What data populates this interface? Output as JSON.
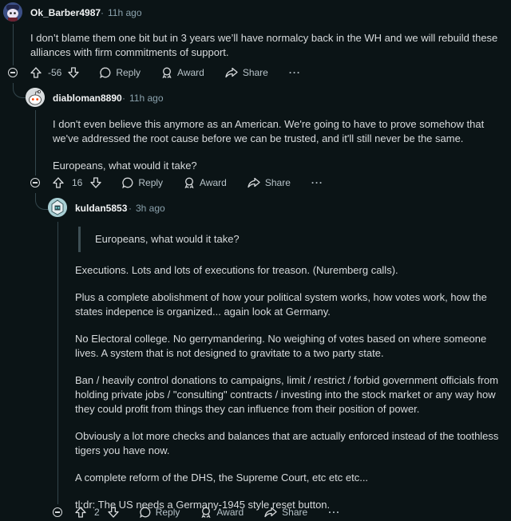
{
  "comments": [
    {
      "username": "Ok_Barber4987",
      "time": "11h ago",
      "paragraphs": [
        "I don’t blame them one bit but in 3 years we’ll have normalcy back in the WH and we will rebuild these alliances with firm commitments of support."
      ],
      "score": "-56",
      "reply": "Reply",
      "award": "Award",
      "share": "Share",
      "more": "···"
    },
    {
      "username": "diabloman8890",
      "time": "11h ago",
      "paragraphs": [
        "I don't even believe this anymore as an American. We're going to have to prove somehow that we've addressed the root cause before we can be trusted, and it'll still never be the same.",
        "Europeans, what would it take?"
      ],
      "score": "16",
      "reply": "Reply",
      "award": "Award",
      "share": "Share",
      "more": "···"
    },
    {
      "username": "kuldan5853",
      "time": "3h ago",
      "quote": "Europeans, what would it take?",
      "paragraphs": [
        "Executions. Lots and lots of executions for treason. (Nuremberg calls).",
        "Plus a complete abolishment of how your political system works, how votes work, how the states indepence is organized... again look at Germany.",
        "No Electoral college. No gerrymandering. No weighing of votes based on where someone lives. A system that is not designed to gravitate to a two party state.",
        "Ban / heavily control donations to campaigns, limit / restrict / forbid government officials from holding private jobs / \"consulting\" contracts / investing into the stock market or any way how they could profit from things they can influence from their position of power.",
        "Obviously a lot more checks and balances that are actually enforced instead of the toothless tigers you have now.",
        "A complete reform of the DHS, the Supreme Court, etc etc etc...",
        "tl;dr: The US needs a Germany-1945 style reset button."
      ],
      "score": "2",
      "reply": "Reply",
      "award": "Award",
      "share": "Share",
      "more": "···"
    }
  ],
  "separator": "·"
}
